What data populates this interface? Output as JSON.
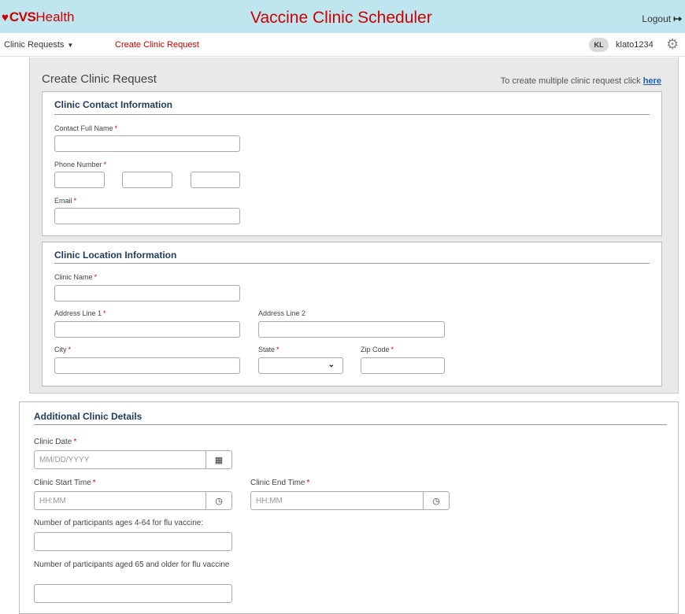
{
  "brand": {
    "heart": "♥",
    "cvs": "CVS",
    "health": "Health"
  },
  "app_title": "Vaccine Clinic Scheduler",
  "header": {
    "logout_label": "Logout",
    "logout_icon": "logout-icon"
  },
  "nav": {
    "clinic_requests_label": "Clinic Requests",
    "create_clinic_request_label": "Create Clinic Request",
    "user_initials": "KL",
    "username": "klato1234"
  },
  "page": {
    "title": "Create Clinic Request",
    "multi_note": "To create multiple clinic request click",
    "multi_link": "here"
  },
  "contact": {
    "title": "Clinic Contact Information",
    "full_name_label": "Contact Full Name",
    "phone_label": "Phone Number",
    "email_label": "Email",
    "required_mark": "*"
  },
  "location": {
    "title": "Clinic Location Information",
    "clinic_name_label": "Clinic Name",
    "address1_label": "Address Line 1",
    "address2_label": "Address Line 2",
    "city_label": "City",
    "state_label": "State",
    "state_value": "",
    "zip_label": "Zip Code"
  },
  "additional": {
    "title": "Additional Clinic Details",
    "clinic_date_label": "Clinic Date",
    "clinic_date_placeholder": "MM/DD/YYYY",
    "start_time_label": "Clinic Start Time",
    "start_time_placeholder": "HH:MM",
    "end_time_label": "Clinic End Time",
    "end_time_placeholder": "HH:MM",
    "participants_4_64_label": "Number of participants ages 4-64 for flu vaccine:",
    "participants_65_label": "Number of participants aged 65 and older for flu vaccine"
  },
  "colors": {
    "brand_red": "#cc0000",
    "topbar_bg": "#bfe6ef",
    "section_title": "#1e3a5a"
  }
}
